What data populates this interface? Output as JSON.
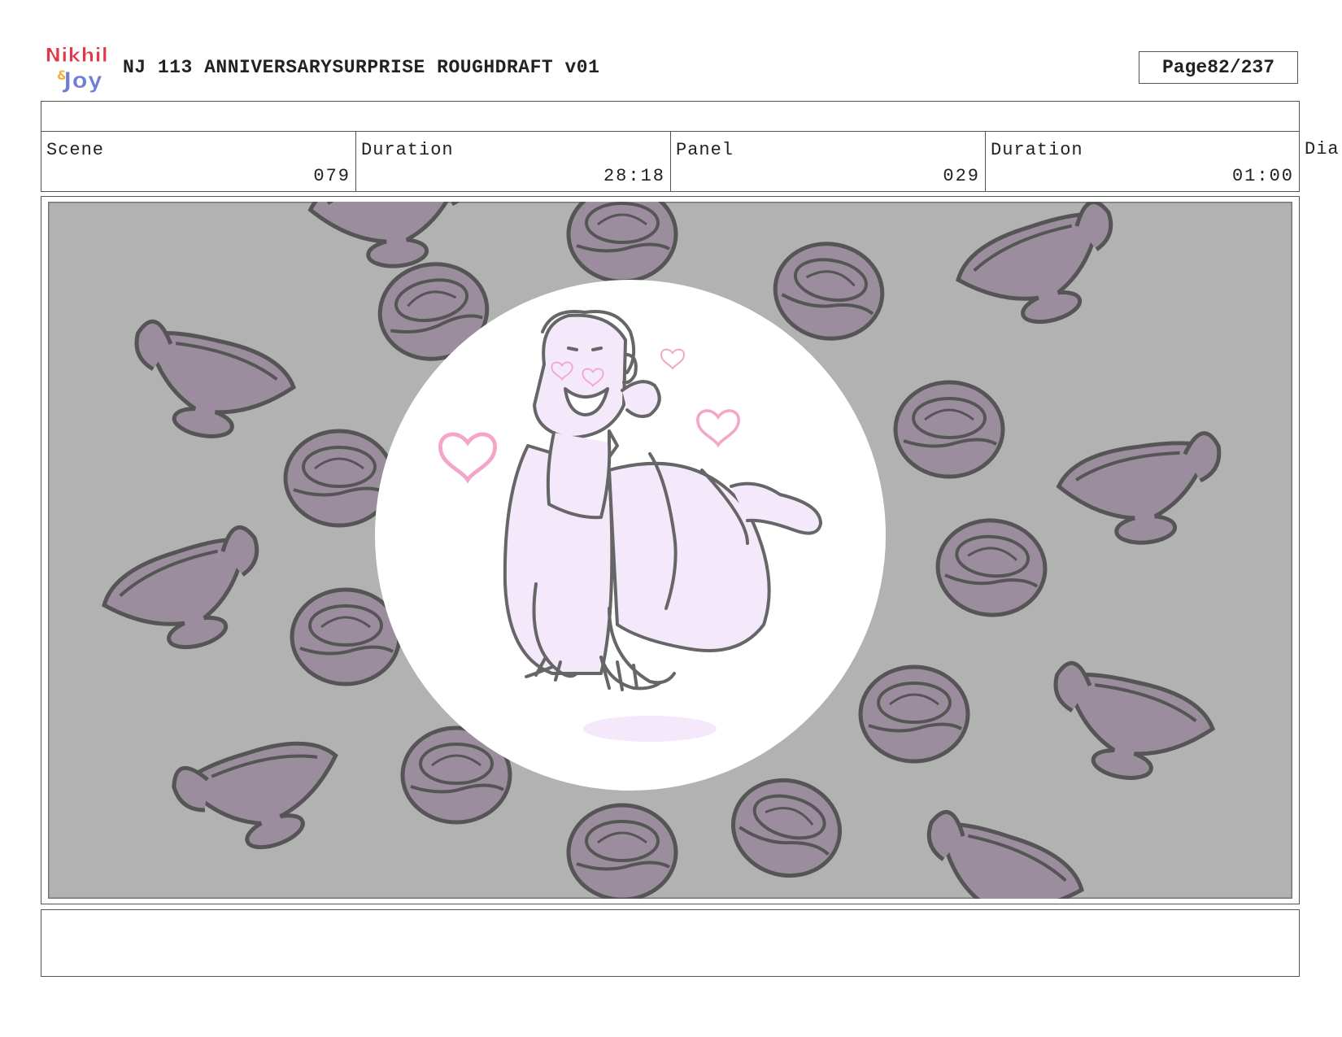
{
  "header": {
    "logo_text": "Nikhil & Joy",
    "title": "NJ 113 ANNIVERSARYSURPRISE ROUGHDRAFT v01",
    "page_label": "Page",
    "page_value": "82/237"
  },
  "info": {
    "scene_label": "Scene",
    "scene_value": "079",
    "scene_duration_label": "Duration",
    "scene_duration_value": "28:18",
    "panel_label": "Panel",
    "panel_value": "029",
    "panel_duration_label": "Duration",
    "panel_duration_value": "01:00",
    "dialogue_label": "Dia"
  },
  "colors": {
    "background_gray": "#b2b2b2",
    "prop_purple": "#9b8d9d",
    "line_gray": "#555555",
    "character_fill": "#f4e8fb",
    "heart_pink": "#f3a6c8",
    "logo_red": "#e2364a",
    "logo_blue": "#6f7dd6"
  }
}
